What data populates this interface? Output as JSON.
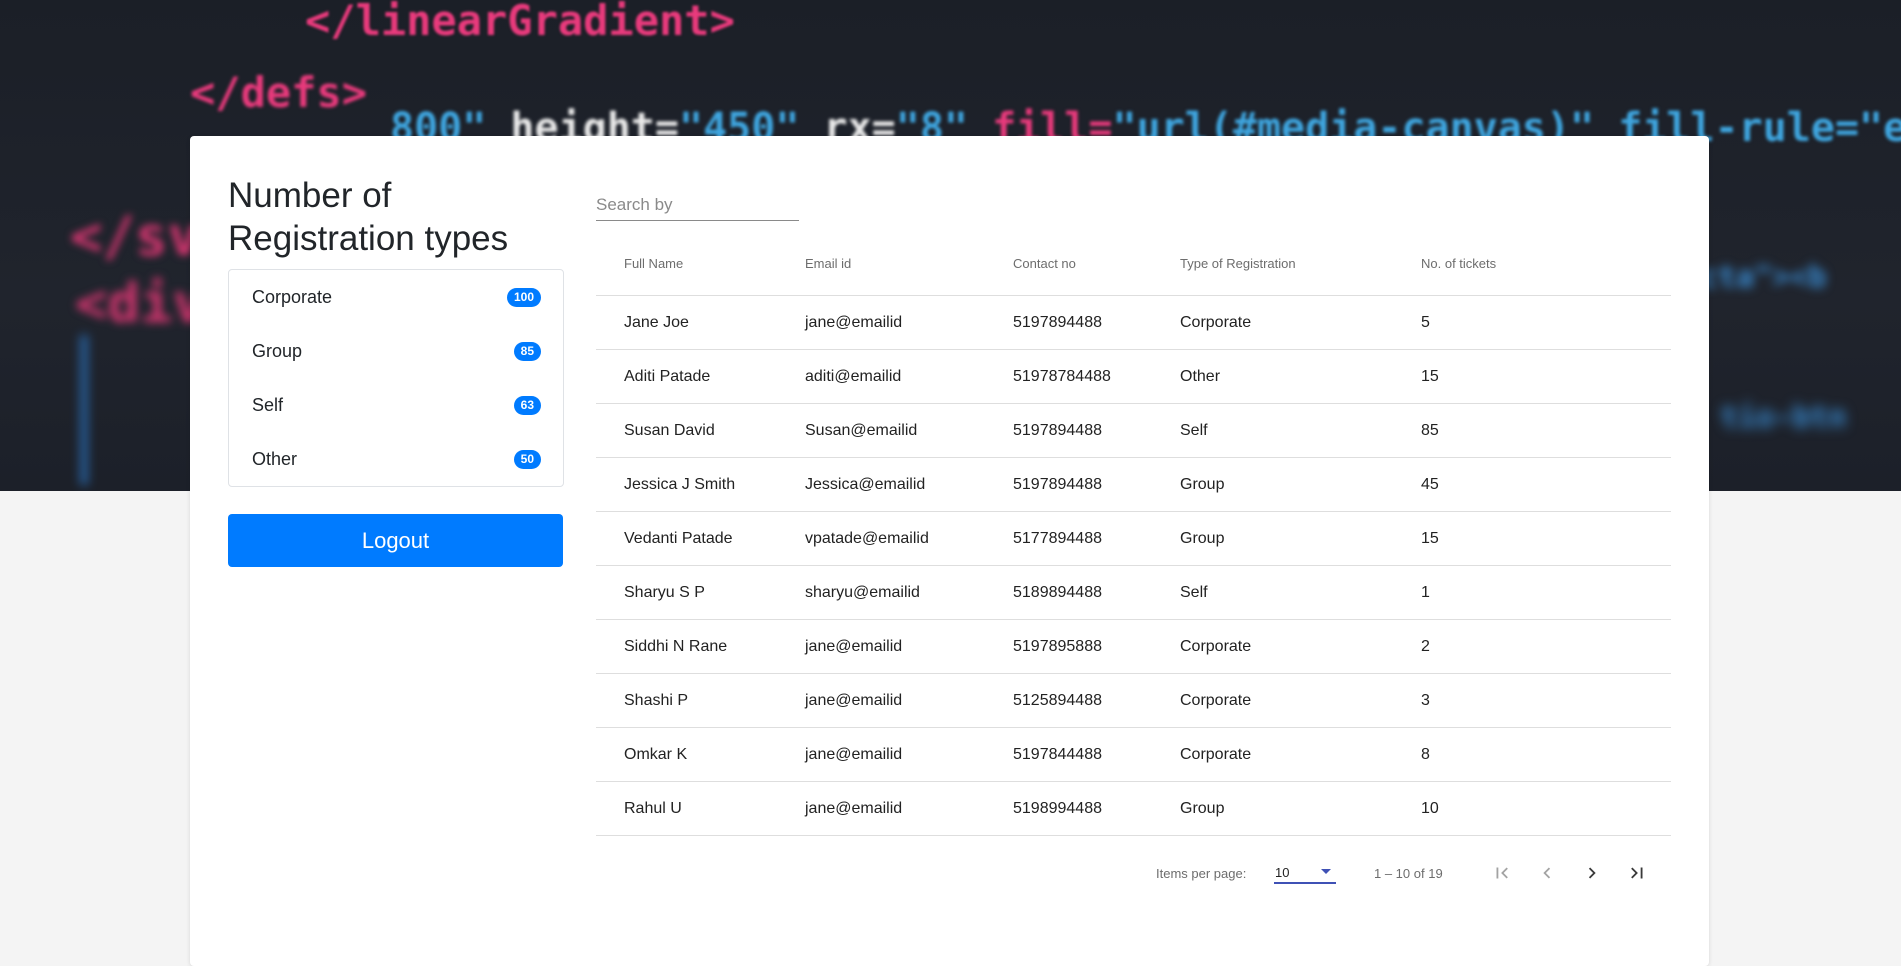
{
  "background": {
    "code_lines": [
      "</linearGradient>",
      "</defs>",
      [
        "800\"",
        " height=",
        "\"450\"",
        " rx=",
        "\"8\"",
        " fill=",
        "\"url(#media-canvas)\" fill-rule=\"evenodd\"/>"
      ],
      "</sv",
      "<div",
      "cta\"><b",
      "tio-btn"
    ]
  },
  "sidebar": {
    "title": "Number of Registration types",
    "registration_types": [
      {
        "label": "Corporate",
        "count": "100"
      },
      {
        "label": "Group",
        "count": "85"
      },
      {
        "label": "Self",
        "count": "63"
      },
      {
        "label": "Other",
        "count": "50"
      }
    ],
    "logout_label": "Logout"
  },
  "search": {
    "placeholder": "Search by",
    "value": ""
  },
  "table": {
    "headers": [
      "Full Name",
      "Email id",
      "Contact no",
      "Type of Registration",
      "No. of tickets"
    ],
    "rows": [
      [
        "Jane Joe",
        "jane@emailid",
        "5197894488",
        "Corporate",
        "5"
      ],
      [
        "Aditi Patade",
        "aditi@emailid",
        "51978784488",
        "Other",
        "15"
      ],
      [
        "Susan David",
        "Susan@emailid",
        "5197894488",
        "Self",
        "85"
      ],
      [
        "Jessica J Smith",
        "Jessica@emailid",
        "5197894488",
        "Group",
        "45"
      ],
      [
        "Vedanti Patade",
        "vpatade@emailid",
        "5177894488",
        "Group",
        "15"
      ],
      [
        "Sharyu S P",
        "sharyu@emailid",
        "5189894488",
        "Self",
        "1"
      ],
      [
        "Siddhi N Rane",
        "jane@emailid",
        "5197895888",
        "Corporate",
        "2"
      ],
      [
        "Shashi P",
        "jane@emailid",
        "5125894488",
        "Corporate",
        "3"
      ],
      [
        "Omkar K",
        "jane@emailid",
        "5197844488",
        "Corporate",
        "8"
      ],
      [
        "Rahul U",
        "jane@emailid",
        "5198994488",
        "Group",
        "10"
      ]
    ]
  },
  "paginator": {
    "items_per_page_label": "Items per page:",
    "items_per_page": "10",
    "range_label": "1 – 10 of 19",
    "icons": [
      "first-page-icon",
      "previous-page-icon",
      "next-page-icon",
      "last-page-icon"
    ]
  },
  "colors": {
    "primary": "#007bff",
    "accent_underline": "#3f51b5"
  }
}
